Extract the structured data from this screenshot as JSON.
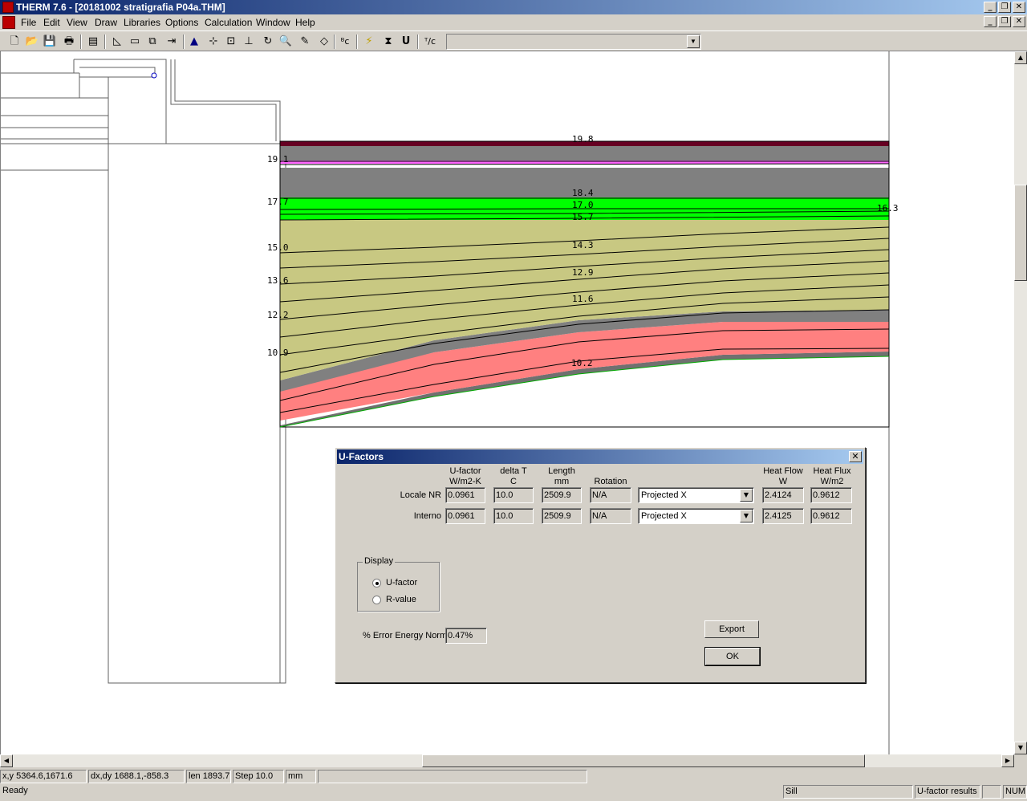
{
  "window": {
    "title": "THERM 7.6 - [20181002 stratigrafia P04a.THM]",
    "min": "_",
    "restore": "❐",
    "close": "✕"
  },
  "menu": [
    "File",
    "Edit",
    "View",
    "Draw",
    "Libraries",
    "Options",
    "Calculation",
    "Window",
    "Help"
  ],
  "toolbar": {
    "icons": [
      "new-icon",
      "open-icon",
      "save-icon",
      "print-icon",
      "properties-icon",
      "draw-polygon-icon",
      "rectangle-icon",
      "copy-icon",
      "locate-icon",
      "fill-void-icon",
      "vertex-icon",
      "insert-point-icon",
      "move-icon",
      "rotate-icon",
      "zoom-icon",
      "pick-icon",
      "flip-icon",
      "boundary-condition-icon",
      "calculate-icon",
      "display-results-icon",
      "u-factor-icon",
      "temperature-icon"
    ],
    "glyphs": [
      "🗋",
      "📂",
      "💾",
      "🖶",
      "▤",
      "◺",
      "▭",
      "⧉",
      "⇥",
      "▲",
      "⊹",
      "⊡",
      "⊥",
      "↻",
      "🔍",
      "✎",
      "◇",
      "ᴮc",
      "⚡",
      "⧗",
      "U",
      "ᵀ/c"
    ],
    "combo_value": ""
  },
  "temperatures": [
    {
      "label": "19.8"
    },
    {
      "label": "19.1"
    },
    {
      "label": "18.4"
    },
    {
      "label": "17.7"
    },
    {
      "label": "17.0"
    },
    {
      "label": "16.3"
    },
    {
      "label": "15.7"
    },
    {
      "label": "15.0"
    },
    {
      "label": "14.3"
    },
    {
      "label": "13.6"
    },
    {
      "label": "12.9"
    },
    {
      "label": "12.2"
    },
    {
      "label": "11.6"
    },
    {
      "label": "10.9"
    },
    {
      "label": "10.2"
    }
  ],
  "dialog": {
    "title": "U-Factors",
    "close": "✕",
    "headers": {
      "ufactor": "U-factor",
      "ufactor_unit": "W/m2-K",
      "deltat": "delta T",
      "deltat_unit": "C",
      "length": "Length",
      "length_unit": "mm",
      "rotation": "Rotation",
      "heatflow": "Heat Flow",
      "heatflow_unit": "W",
      "heatflux": "Heat Flux",
      "heatflux_unit": "W/m2"
    },
    "rows": [
      {
        "name": "Locale NR",
        "ufactor": "0.0961",
        "deltat": "10.0",
        "length": "2509.9",
        "rotation": "N/A",
        "projection": "Projected X",
        "heatflow": "2.4124",
        "heatflux": "0.9612"
      },
      {
        "name": "Interno",
        "ufactor": "0.0961",
        "deltat": "10.0",
        "length": "2509.9",
        "rotation": "N/A",
        "projection": "Projected X",
        "heatflow": "2.4125",
        "heatflux": "0.9612"
      }
    ],
    "display": {
      "legend": "Display",
      "ufactor": "U-factor",
      "rvalue": "R-value",
      "selected": "U-factor"
    },
    "error_label": "% Error Energy Norm",
    "error_value": "0.47%",
    "export": "Export",
    "ok": "OK"
  },
  "status": {
    "xy": "x,y 5364.6,1671.6",
    "dxdy": "dx,dy 1688.1,-858.3",
    "len": "len 1893.7",
    "step": "Step  10.0",
    "unit": "mm",
    "ready": "Ready",
    "element": "Sill",
    "mode": "U-factor results",
    "num": "NUM"
  },
  "colors": {
    "pink": "#ff8080",
    "olive": "#c8c882",
    "green": "#00ff00",
    "gray": "#808080",
    "magenta": "#ff66ff",
    "maroon": "#660022"
  }
}
